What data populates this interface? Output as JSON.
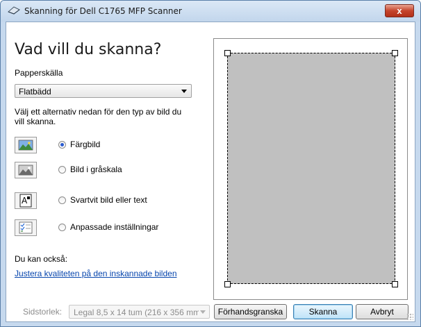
{
  "window": {
    "title": "Skanning för Dell C1765 MFP Scanner",
    "close_label": "x"
  },
  "main": {
    "heading": "Vad vill du skanna?",
    "source_label": "Papperskälla",
    "source_value": "Flatbädd",
    "description": "Välj ett alternativ nedan för den typ av bild du vill skanna.",
    "options": [
      {
        "label": "Färgbild",
        "checked": true,
        "icon": "color-picture-icon"
      },
      {
        "label": "Bild i gråskala",
        "checked": false,
        "icon": "grayscale-picture-icon"
      },
      {
        "label": "Svartvit bild eller text",
        "checked": false,
        "icon": "black-white-text-icon"
      },
      {
        "label": "Anpassade inställningar",
        "checked": false,
        "icon": "custom-settings-icon"
      }
    ],
    "also_label": "Du kan också:",
    "adjust_link": "Justera kvaliteten på den inskannade bilden"
  },
  "footer": {
    "page_size_label": "Sidstorlek:",
    "page_size_value": "Legal 8,5 x 14 tum (216 x 356 mm)",
    "preview_button": "Förhandsgranska",
    "scan_button": "Skanna",
    "cancel_button": "Avbryt"
  },
  "colors": {
    "titlebar": "#c6d9ee",
    "close_button": "#c5442c",
    "scan_area": "#c0c0c0",
    "link": "#0645ad"
  }
}
